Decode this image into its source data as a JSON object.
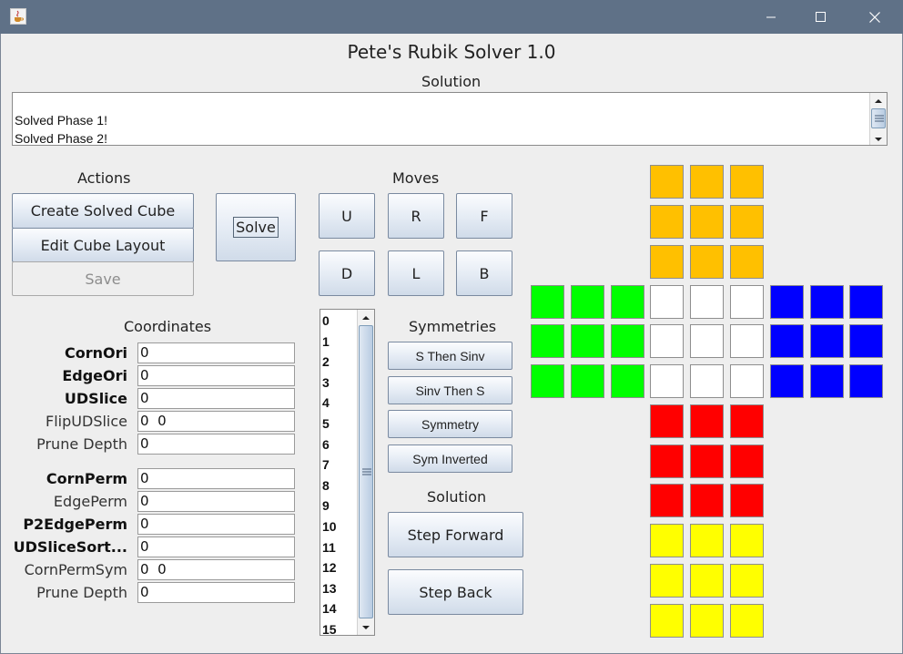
{
  "window": {
    "app_title": "Pete's Rubik Solver 1.0"
  },
  "solution_panel": {
    "label": "Solution",
    "lines": [
      "Solved Phase 1!",
      "Solved Phase 2!"
    ]
  },
  "actions": {
    "label": "Actions",
    "create_solved_cube": "Create Solved Cube",
    "edit_cube_layout": "Edit Cube Layout",
    "save": "Save",
    "solve": "Solve"
  },
  "moves": {
    "label": "Moves",
    "buttons": [
      "U",
      "R",
      "F",
      "D",
      "L",
      "B"
    ]
  },
  "coordinates": {
    "label": "Coordinates",
    "rows": [
      {
        "label": "CornOri",
        "value": "0",
        "bold": true
      },
      {
        "label": "EdgeOri",
        "value": "0",
        "bold": true
      },
      {
        "label": "UDSlice",
        "value": "0",
        "bold": true
      },
      {
        "label": "FlipUDSlice",
        "value": "0  0",
        "bold": false
      },
      {
        "label": "Prune Depth",
        "value": "0",
        "bold": false
      },
      {
        "label": "CornPerm",
        "value": "0",
        "bold": true
      },
      {
        "label": "EdgePerm",
        "value": "0",
        "bold": false
      },
      {
        "label": "P2EdgePerm",
        "value": "0",
        "bold": true
      },
      {
        "label": "UDSliceSort...",
        "value": "0",
        "bold": true
      },
      {
        "label": "CornPermSym",
        "value": "0  0",
        "bold": false
      },
      {
        "label": "Prune Depth",
        "value": "0",
        "bold": false
      }
    ]
  },
  "symmetry_list": {
    "items": [
      "0",
      "1",
      "2",
      "3",
      "4",
      "5",
      "6",
      "7",
      "8",
      "9",
      "10",
      "11",
      "12",
      "13",
      "14",
      "15"
    ]
  },
  "symmetries": {
    "label": "Symmetries",
    "buttons": [
      "S Then Sinv",
      "Sinv Then S",
      "Symmetry",
      "Sym Inverted"
    ]
  },
  "solution_steps": {
    "label": "Solution",
    "step_forward": "Step Forward",
    "step_back": "Step Back"
  },
  "cube": {
    "colors": {
      "orange": "#ffc000",
      "green": "#00ff00",
      "white": "#ffffff",
      "blue": "#0000ff",
      "red": "#ff0000",
      "yellow": "#ffff00"
    },
    "faces": {
      "top": "orange",
      "left": "green",
      "front": "white",
      "right": "blue",
      "bottom": "red",
      "back": "yellow"
    }
  }
}
